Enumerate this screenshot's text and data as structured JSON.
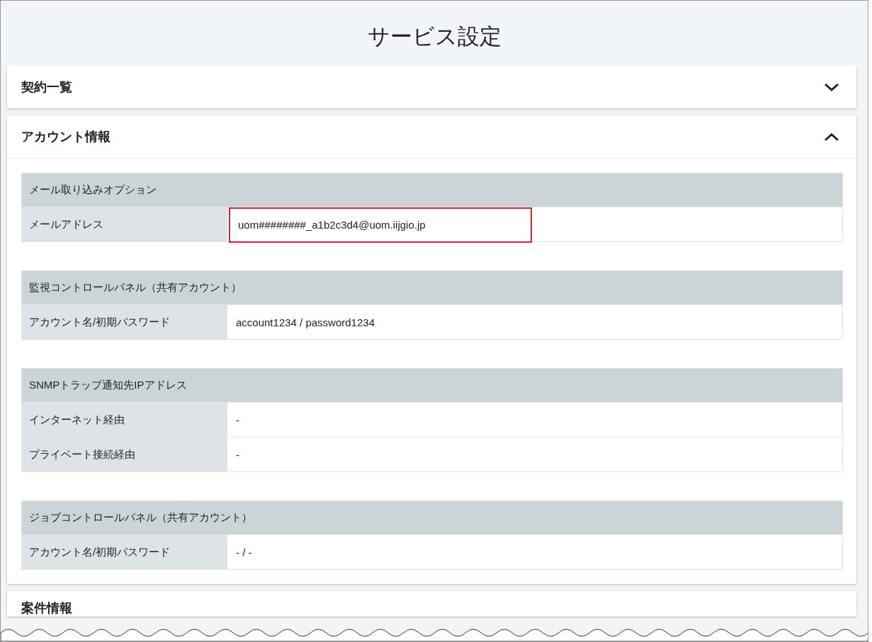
{
  "page": {
    "title": "サービス設定"
  },
  "panels": [
    {
      "title": "契約一覧",
      "expanded": false
    },
    {
      "title": "アカウント情報",
      "expanded": true,
      "groups": [
        {
          "heading": "メール取り込みオプション",
          "rows": [
            {
              "label": "メールアドレス",
              "value": "uom########_a1b2c3d4@uom.iijgio.jp",
              "highlighted": true
            }
          ]
        },
        {
          "heading": "監視コントロールパネル（共有アカウント）",
          "rows": [
            {
              "label": "アカウント名/初期パスワード",
              "value": "account1234 / password1234",
              "highlighted": false
            }
          ]
        },
        {
          "heading": "SNMPトラップ通知先IPアドレス",
          "rows": [
            {
              "label": "インターネット経由",
              "value": "-",
              "highlighted": false
            },
            {
              "label": "プライベート接続経由",
              "value": "-",
              "highlighted": false
            }
          ]
        },
        {
          "heading": "ジョブコントロールパネル（共有アカウント）",
          "rows": [
            {
              "label": "アカウント名/初期パスワード",
              "value": "- / -",
              "highlighted": false
            }
          ]
        }
      ]
    },
    {
      "title": "案件情報"
    }
  ]
}
